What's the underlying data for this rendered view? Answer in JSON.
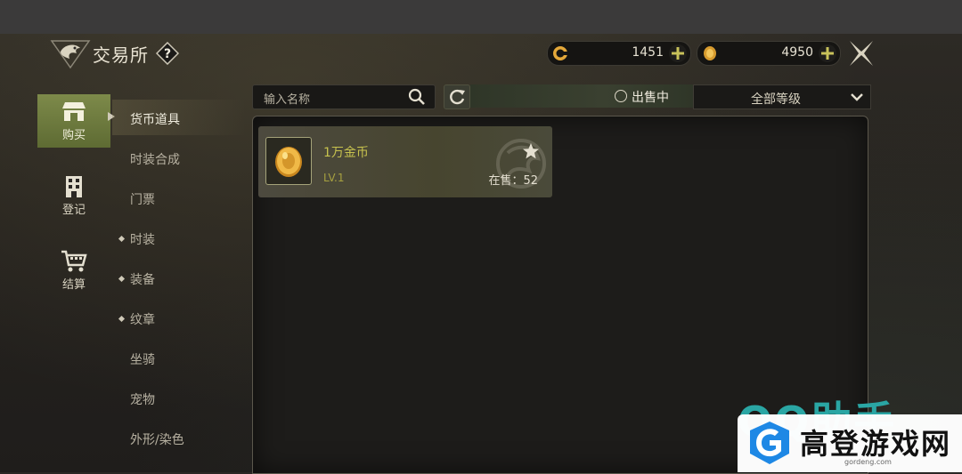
{
  "header": {
    "title": "交易所",
    "help_icon": "question-icon"
  },
  "currency": [
    {
      "icon": "coin-ring-icon",
      "value": "1451"
    },
    {
      "icon": "gold-coin-icon",
      "value": "4950"
    }
  ],
  "sidebar": {
    "items": [
      {
        "label": "购买",
        "icon": "shop-icon",
        "active": true
      },
      {
        "label": "登记",
        "icon": "building-icon",
        "active": false
      },
      {
        "label": "结算",
        "icon": "cart-icon",
        "active": false
      }
    ]
  },
  "categories": [
    {
      "label": "货币道具",
      "active": true,
      "dot": false
    },
    {
      "label": "时装合成",
      "active": false,
      "dot": false
    },
    {
      "label": "门票",
      "active": false,
      "dot": false
    },
    {
      "label": "时装",
      "active": false,
      "dot": true
    },
    {
      "label": "装备",
      "active": false,
      "dot": true
    },
    {
      "label": "纹章",
      "active": false,
      "dot": true
    },
    {
      "label": "坐骑",
      "active": false,
      "dot": false
    },
    {
      "label": "宠物",
      "active": false,
      "dot": false
    },
    {
      "label": "外形/染色",
      "active": false,
      "dot": false
    }
  ],
  "toolbar": {
    "search_placeholder": "输入名称",
    "on_sale_label": "出售中",
    "level_filter": "全部等级"
  },
  "items": [
    {
      "name": "1万金币",
      "level": "LV.1",
      "sale_text": "在售：52"
    }
  ],
  "watermark": {
    "qq_text": "QQ助手",
    "site_name": "高登游戏网",
    "site_url": "gordeng.com"
  },
  "colors": {
    "accent_green": "#6f7d3c",
    "item_name": "#c7c24e",
    "watermark_blue": "#1e88e5"
  }
}
